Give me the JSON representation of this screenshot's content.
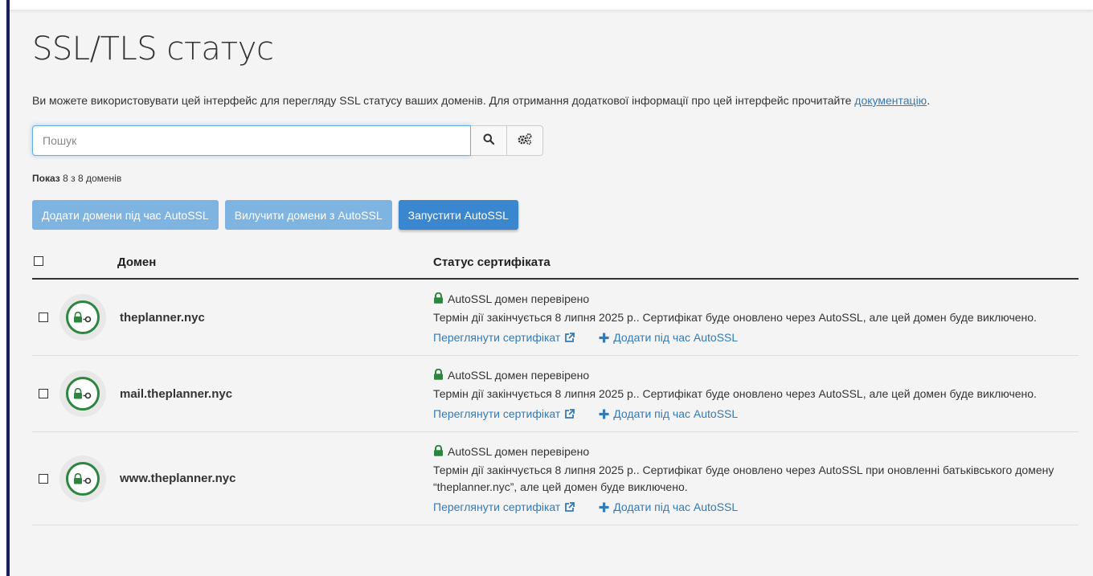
{
  "page": {
    "title": "SSL/TLS статус",
    "intro_text": "Ви можете використовувати цей інтерфейс для перегляду SSL статусу ваших доменів. Для отримання додаткової інформації про цей інтерфейс прочитайте ",
    "intro_link": "документацію",
    "intro_end": "."
  },
  "search": {
    "placeholder": "Пошук",
    "search_icon": "search-icon",
    "settings_icon": "gears-icon"
  },
  "count": {
    "prefix": "Показ",
    "text": "8 з 8 доменів"
  },
  "actions": {
    "add": "Додати домени під час AutoSSL",
    "exclude": "Вилучити домени з AutoSSL",
    "run": "Запустити AutoSSL"
  },
  "table": {
    "col_domain": "Домен",
    "col_status": "Статус сертифіката",
    "rows": [
      {
        "domain": "theplanner.nyc",
        "status": "AutoSSL домен перевірено",
        "message": "Термін дії закінчується 8 липня 2025 р.. Сертифікат буде оновлено через AutoSSL, але цей домен буде виключено.",
        "view_link": "Переглянути сертифікат",
        "add_link": "Додати під час AutoSSL"
      },
      {
        "domain": "mail.theplanner.nyc",
        "status": "AutoSSL домен перевірено",
        "message": "Термін дії закінчується 8 липня 2025 р.. Сертифікат буде оновлено через AutoSSL, але цей домен буде виключено.",
        "view_link": "Переглянути сертифікат",
        "add_link": "Додати під час AutoSSL"
      },
      {
        "domain": "www.theplanner.nyc",
        "status": "AutoSSL домен перевірено",
        "message": "Термін дії закінчується 8 липня 2025 р.. Сертифікат буде оновлено через AutoSSL при оновленні батьківського домену “theplanner.nyc”, але цей домен буде виключено.",
        "view_link": "Переглянути сертифікат",
        "add_link": "Додати під час AutoSSL"
      }
    ]
  },
  "colors": {
    "accent_bar": "#1a1f5c",
    "link": "#337ab7",
    "lock_green": "#2e8540",
    "button_primary": "#3a87cf",
    "button_disabled": "#7fb3e0"
  }
}
